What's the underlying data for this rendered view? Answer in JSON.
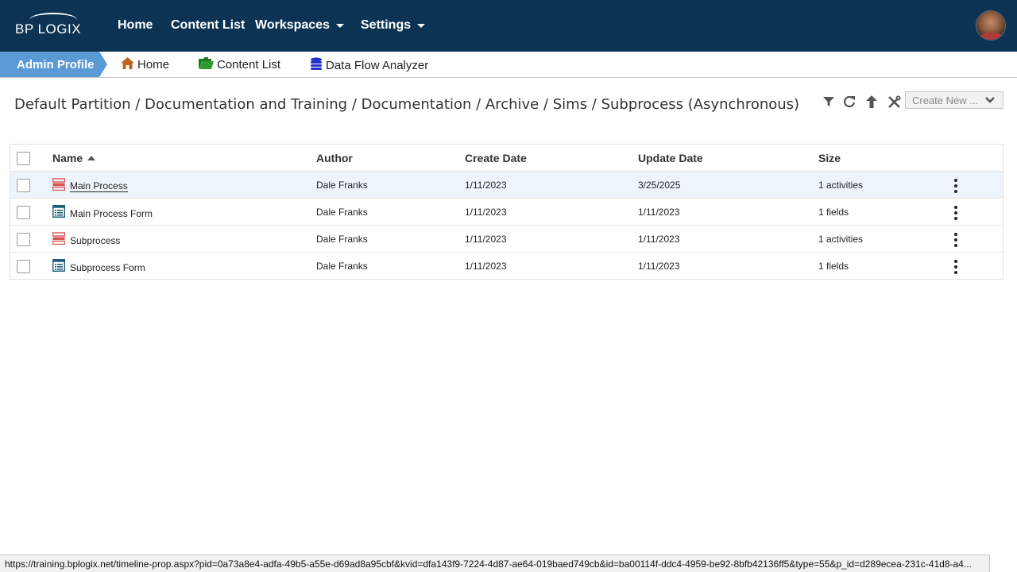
{
  "app": {
    "logo_text": "BP LOGIX"
  },
  "topnav": {
    "items": [
      {
        "label": "Home"
      },
      {
        "label": "Content List"
      },
      {
        "label": "Workspaces"
      },
      {
        "label": "Settings"
      }
    ]
  },
  "subbar": {
    "profile_label": "Admin Profile",
    "shortcuts": [
      {
        "label": "Home",
        "icon": "house-icon"
      },
      {
        "label": "Content List",
        "icon": "folder-icon"
      },
      {
        "label": "Data Flow Analyzer",
        "icon": "database-icon"
      }
    ]
  },
  "breadcrumb": {
    "path": "Default Partition / Documentation and Training / Documentation / Archive / Sims / Subprocess (Asynchronous)"
  },
  "toolbar": {
    "icons": [
      "filter-icon",
      "refresh-icon",
      "up-arrow-icon",
      "tools-icon"
    ],
    "create_new_label": "Create New ..."
  },
  "table": {
    "columns": [
      "Name",
      "Author",
      "Create Date",
      "Update Date",
      "Size"
    ],
    "sort_column": "Name",
    "sort_direction": "ascending",
    "rows": [
      {
        "name": "Main Process",
        "type": "process",
        "author": "Dale Franks",
        "create_date": "1/11/2023",
        "update_date": "3/25/2025",
        "size": "1 activities"
      },
      {
        "name": "Main Process Form",
        "type": "form",
        "author": "Dale Franks",
        "create_date": "1/11/2023",
        "update_date": "1/11/2023",
        "size": "1 fields"
      },
      {
        "name": "Subprocess",
        "type": "process",
        "author": "Dale Franks",
        "create_date": "1/11/2023",
        "update_date": "1/11/2023",
        "size": "1 activities"
      },
      {
        "name": "Subprocess Form",
        "type": "form",
        "author": "Dale Franks",
        "create_date": "1/11/2023",
        "update_date": "1/11/2023",
        "size": "1 fields"
      }
    ]
  },
  "statusbar": {
    "url": "https://training.bplogix.net/timeline-prop.aspx?pid=0a73a8e4-adfa-49b5-a55e-d69ad8a95cbf&kvid=dfa143f9-7224-4d87-ae64-019baed749cb&id=ba00114f-ddc4-4959-be92-8bfb42136ff5&type=55&p_id=d289ecea-231c-41d8-a4..."
  },
  "colors": {
    "topbar": "#0d3354",
    "profile_tab": "#5b9bd5",
    "process_icon": "#d9534f",
    "form_icon": "#1f5f7a",
    "folder_icon": "#2e9b2e",
    "home_icon": "#c0621a",
    "database_icon": "#2231c9"
  }
}
